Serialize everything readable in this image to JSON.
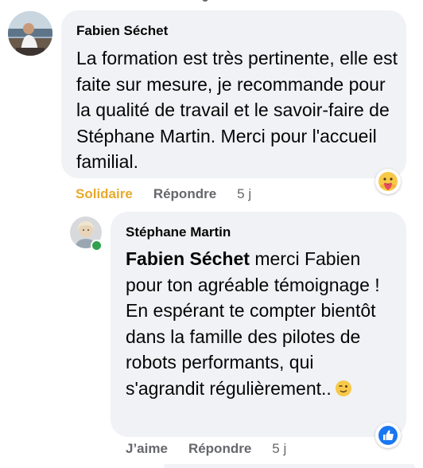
{
  "comments": [
    {
      "author": "Fabien Séchet",
      "body": "La formation est très pertinente, elle est faite sur mesure, je recommande pour la qualité de travail et le savoir-faire de Stéphane Martin. Merci pour l'accueil familial.",
      "actions": {
        "react_label": "Solidaire",
        "reply_label": "Répondre",
        "time": "5 j"
      },
      "reaction_icon": "care-reaction-icon",
      "colors": {
        "react_label": "#e8a92b"
      }
    },
    {
      "author": "Stéphane Martin",
      "mention": "Fabien Séchet",
      "body": " merci Fabien pour ton agréable témoignage ! En espérant te compter bientôt dans la famille des pilotes de robots performants, qui s'agrandit régulièrement..",
      "emoji": "winking-face-icon",
      "actions": {
        "like_label": "J’aime",
        "reply_label": "Répondre",
        "time": "5 j"
      },
      "reaction_icon": "like-reaction-icon",
      "online": true,
      "colors": {
        "online": "#31a24c",
        "like_badge": "#1877f2"
      }
    }
  ],
  "colors": {
    "bubble": "#f0f2f5",
    "secondary_text": "#65676b"
  }
}
